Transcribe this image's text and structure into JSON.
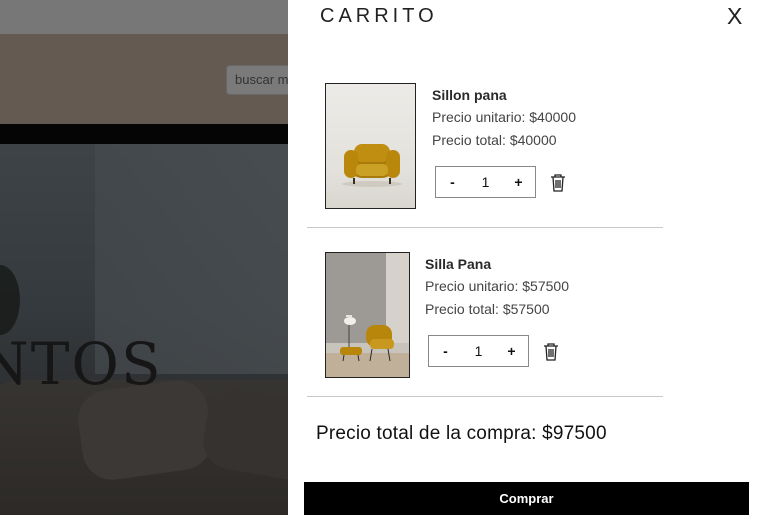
{
  "background": {
    "search_placeholder": "buscar m",
    "hero_text": "NTOS"
  },
  "cart": {
    "title": "CARRITO",
    "close_label": "X",
    "items": [
      {
        "name": "Sillon pana",
        "unit_price": "Precio unitario: $40000",
        "total_price": "Precio total: $40000",
        "quantity": "1",
        "minus_label": "-",
        "plus_label": "+"
      },
      {
        "name": "Silla Pana",
        "unit_price": "Precio unitario: $57500",
        "total_price": "Precio total: $57500",
        "quantity": "1",
        "minus_label": "-",
        "plus_label": "+"
      }
    ],
    "grand_total": "Precio total de la compra: $97500",
    "buy_label": "Comprar"
  },
  "colors": {
    "overlay": "#00000080",
    "button_bg": "#000000",
    "button_text": "#ffffff",
    "chair_mustard": "#b8860b"
  },
  "icons": {
    "close": "close-icon",
    "delete": "trash-icon"
  }
}
